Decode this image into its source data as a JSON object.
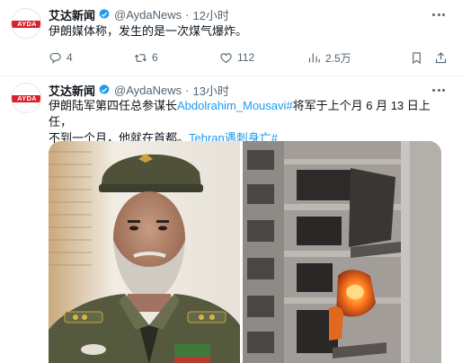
{
  "tweets": [
    {
      "author": "艾达新闻",
      "handle": "@AydaNews",
      "time": "12小时",
      "avatar_text": "AYDA",
      "text": "伊朗媒体称，发生的是一次煤气爆炸。",
      "actions": {
        "reply": "4",
        "retweet": "6",
        "like": "112",
        "views": "2.5万"
      }
    },
    {
      "author": "艾达新闻",
      "handle": "@AydaNews",
      "time": "13小时",
      "avatar_text": "AYDA",
      "text_line1_a": "伊朗陆军第四任总参谋长",
      "text_line1_link": "Abdolrahim_Mousavi#",
      "text_line1_b": "将军于上个月 6 月 13 日上任，",
      "text_line2_a": "不到一个月，他就在首都。",
      "text_line2_link": "Tehran遇刺身亡#"
    }
  ],
  "colors": {
    "accent": "#1d9bf0",
    "text": "#0f1419",
    "muted": "#536471",
    "brand_red": "#d9202a"
  },
  "icons": {
    "verified": "verified-badge-icon",
    "more": "more-icon",
    "reply": "reply-icon",
    "retweet": "retweet-icon",
    "like": "heart-icon",
    "views": "views-icon",
    "bookmark": "bookmark-icon",
    "share": "share-icon"
  }
}
